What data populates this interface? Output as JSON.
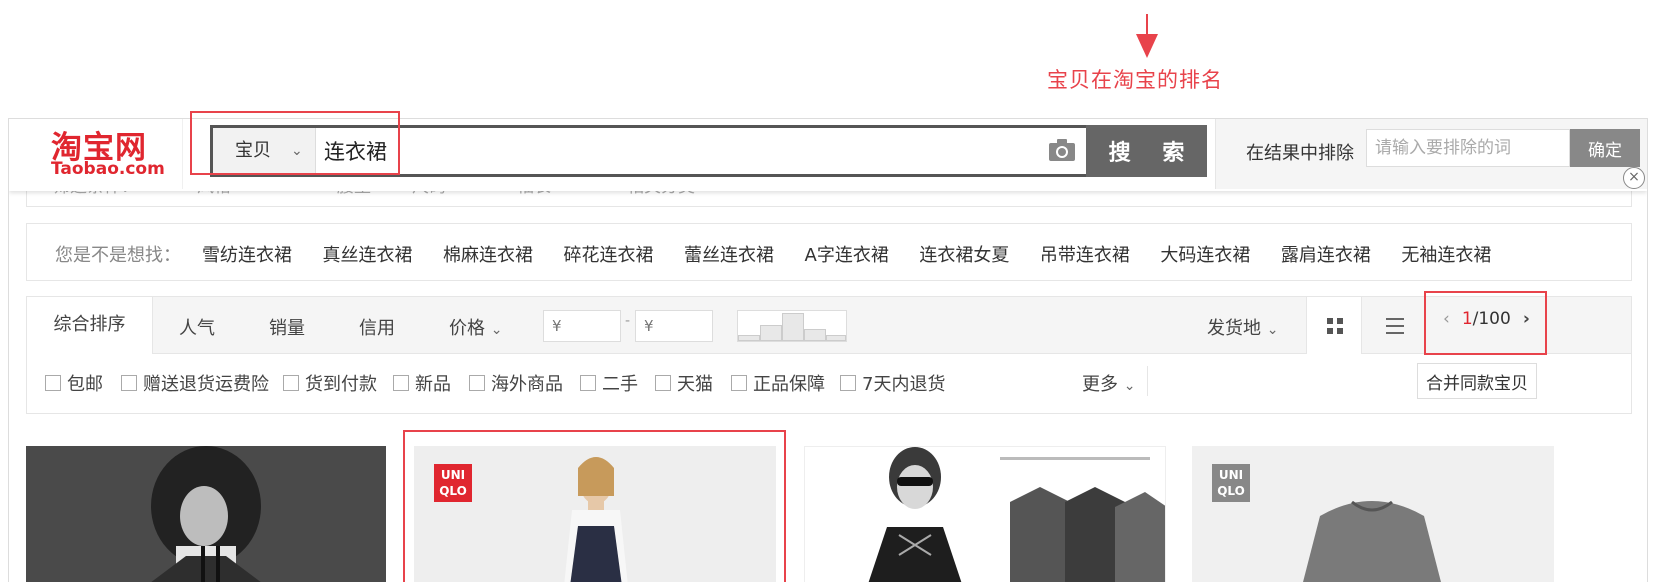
{
  "annotation": {
    "rank_label": "宝贝在淘宝的排名"
  },
  "header": {
    "logo_cn": "淘宝网",
    "logo_en": "Taobao.com",
    "search_type": "宝贝",
    "search_query": "连衣裙",
    "search_button": "搜 索",
    "exclude_label": "在结果中排除",
    "exclude_placeholder": "请输入要排除的词",
    "exclude_button": "确定"
  },
  "peek_filters": [
    "筛选条件：",
    "风格",
    "腰型",
    "尺码",
    "袖长",
    "相关分类"
  ],
  "suggestions": {
    "label": "您是不是想找：",
    "items": [
      "雪纺连衣裙",
      "真丝连衣裙",
      "棉麻连衣裙",
      "碎花连衣裙",
      "蕾丝连衣裙",
      "A字连衣裙",
      "连衣裙女夏",
      "吊带连衣裙",
      "大码连衣裙",
      "露肩连衣裙",
      "无袖连衣裙"
    ]
  },
  "sort": {
    "default": "综合排序",
    "popularity": "人气",
    "sales": "销量",
    "credit": "信用",
    "price": "价格",
    "price_min_placeholder": "¥",
    "price_max_placeholder": "¥",
    "price_dash": "-",
    "ship_from": "发货地",
    "page_current": "1",
    "page_total": "/100"
  },
  "filters": {
    "checkboxes": [
      "包邮",
      "赠送退货运费险",
      "货到付款",
      "新品",
      "海外商品",
      "二手",
      "天猫",
      "正品保障",
      "7天内退货"
    ],
    "more": "更多",
    "merge_button": "合并同款宝贝"
  },
  "products": [
    {
      "brand_badge": ""
    },
    {
      "brand_badge": "UNI QLO"
    },
    {
      "brand_badge": ""
    },
    {
      "brand_badge": "UNI QLO"
    }
  ],
  "colors": {
    "accent": "#e0262f",
    "annotation": "#e8434b",
    "search_button": "#666666"
  }
}
